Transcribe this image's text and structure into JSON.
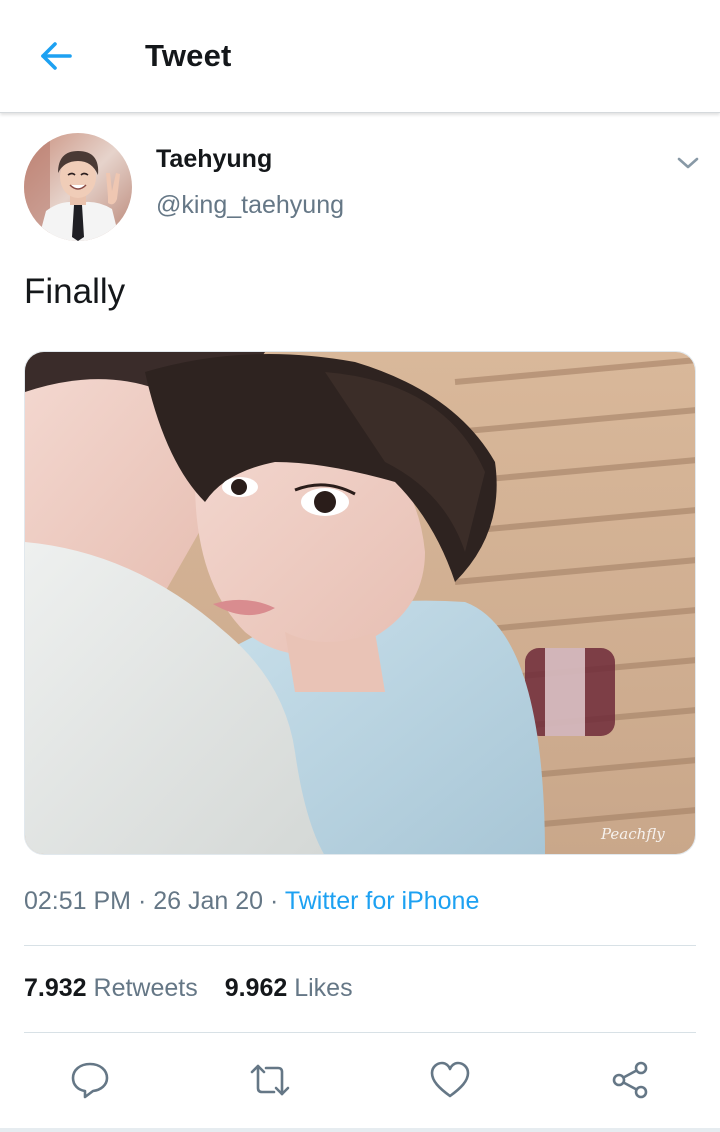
{
  "header": {
    "title": "Tweet",
    "back_icon": "arrow-left-icon"
  },
  "author": {
    "name": "Taehyung",
    "handle": "@king_taehyung"
  },
  "tweet": {
    "text": "Finally",
    "media_watermark": "Peachfly"
  },
  "meta": {
    "time": "02:51 PM",
    "separator1": " · ",
    "date": "26 Jan 20",
    "separator2": " · ",
    "source": "Twitter for iPhone"
  },
  "stats": {
    "retweets_count": "7.932",
    "retweets_label": "Retweets",
    "likes_count": "9.962",
    "likes_label": "Likes"
  },
  "actions": [
    "reply-icon",
    "retweet-icon",
    "like-icon",
    "share-icon"
  ],
  "colors": {
    "accent": "#1da1f2",
    "text_primary": "#14171a",
    "text_secondary": "#657786",
    "divider": "#d8e1e6"
  }
}
